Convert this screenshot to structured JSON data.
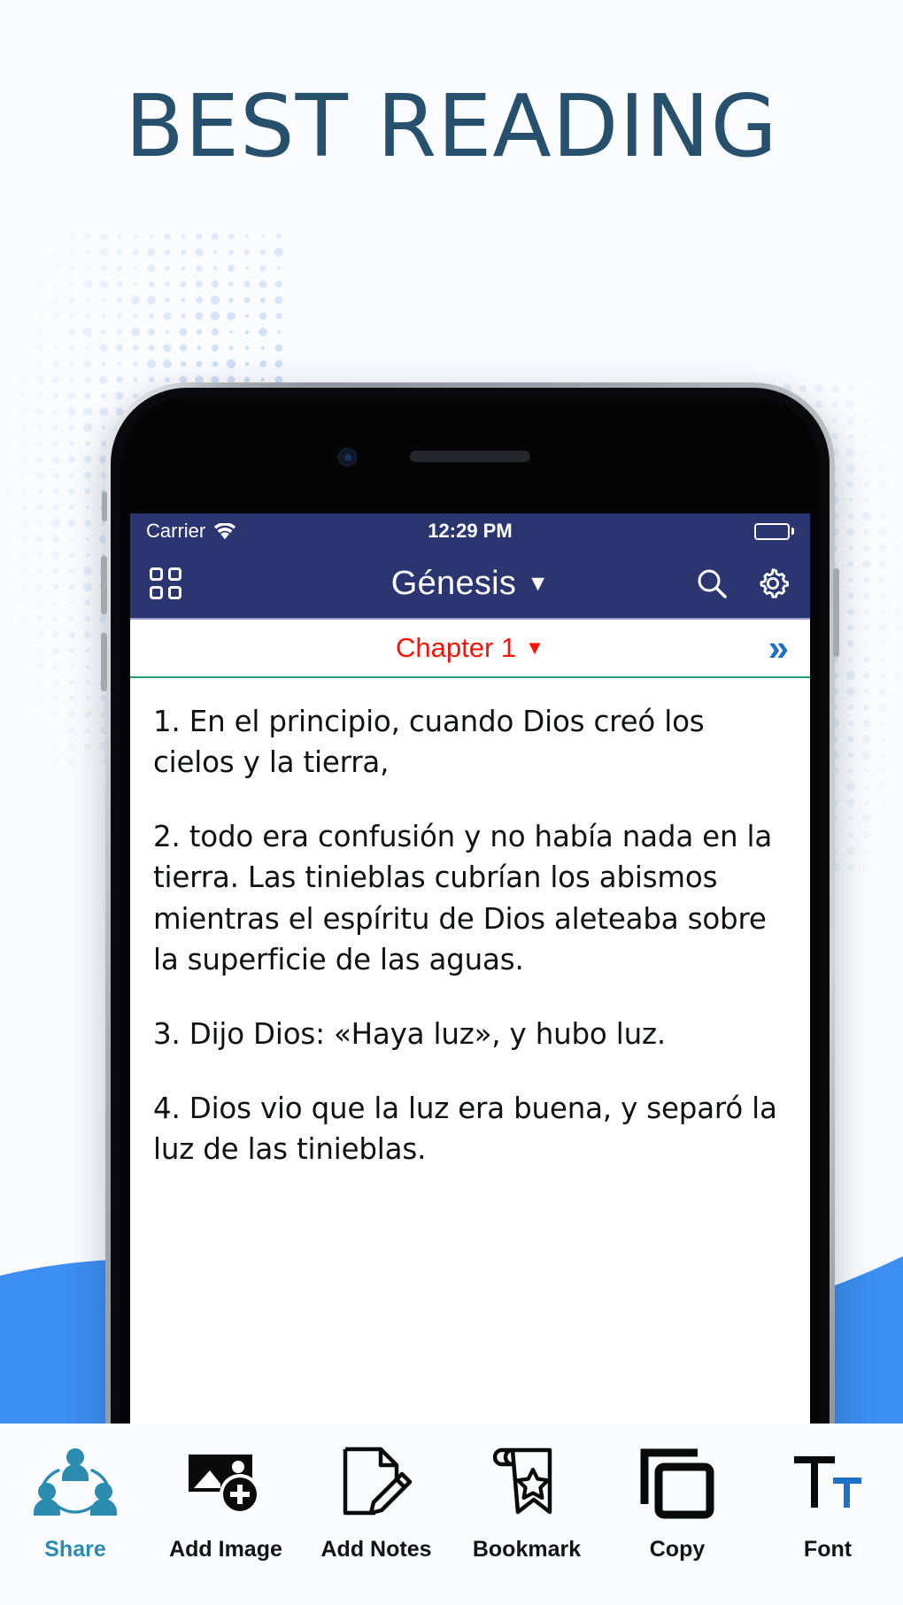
{
  "headline": "BEST READING",
  "colors": {
    "headline": "#27506c",
    "nav_bar": "#2b3570",
    "chapter_text": "#fb1206",
    "chapter_divider": "#2a9d76",
    "next_chevron": "#1d71c8",
    "share_accent": "#2b8cb0",
    "wave": "#3c8ef0",
    "dots": "#bcd2f0"
  },
  "phone": {
    "status_bar": {
      "carrier": "Carrier",
      "wifi_icon": "wifi-icon",
      "time": "12:29 PM",
      "battery_icon": "battery-full-icon"
    },
    "nav_bar": {
      "grid_icon": "grid-menu-icon",
      "title": "Génesis",
      "title_caret": "▼",
      "search_icon": "search-icon",
      "settings_icon": "gear-icon"
    },
    "chapter_bar": {
      "label": "Chapter 1",
      "caret": "▼",
      "next_icon": "»"
    },
    "verses": [
      "1. En el principio, cuando Dios creó los cielos y la tierra,",
      "2. todo era confusión y no había nada en la tierra. Las tinieblas cubrían los abismos mientras el espíritu de Dios aleteaba sobre la superficie de las aguas.",
      "3. Dijo Dios: «Haya luz», y hubo luz.",
      "4. Dios vio que la luz era buena, y separó la luz de las tinieblas."
    ]
  },
  "toolbar": [
    {
      "label": "Share",
      "icon": "share-people-icon",
      "accent": true
    },
    {
      "label": "Add Image",
      "icon": "add-image-icon",
      "accent": false
    },
    {
      "label": "Add Notes",
      "icon": "note-pencil-icon",
      "accent": false
    },
    {
      "label": "Bookmark",
      "icon": "bookmark-star-icon",
      "accent": false
    },
    {
      "label": "Copy",
      "icon": "copy-icon",
      "accent": false
    },
    {
      "label": "Font",
      "icon": "font-size-icon",
      "accent": false
    }
  ]
}
